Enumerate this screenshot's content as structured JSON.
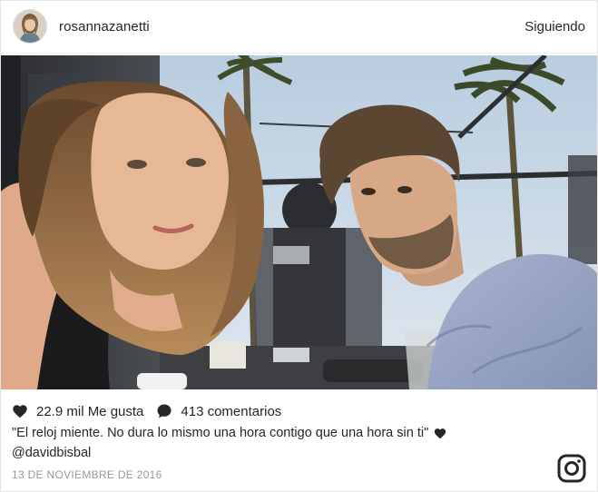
{
  "header": {
    "username": "rosannazanetti",
    "follow_status": "Siguiendo",
    "avatar_icon": "profile-avatar"
  },
  "photo": {
    "icon": "selfie-photo"
  },
  "stats": {
    "likes": "22.9 mil Me gusta",
    "comments": "413 comentarios",
    "like_icon": "heart-icon",
    "comment_icon": "comment-bubble-icon"
  },
  "caption": {
    "text": "\"El reloj miente. No dura lo mismo una hora contigo que una hora sin ti\"",
    "emoji_icon": "heart-icon",
    "mention": "@davidbisbal"
  },
  "date": "13 DE NOVIEMBRE DE 2016",
  "brand": {
    "icon": "instagram-logo-icon"
  },
  "colors": {
    "text": "#262626",
    "muted": "#999999",
    "border": "#e6e6e6"
  }
}
